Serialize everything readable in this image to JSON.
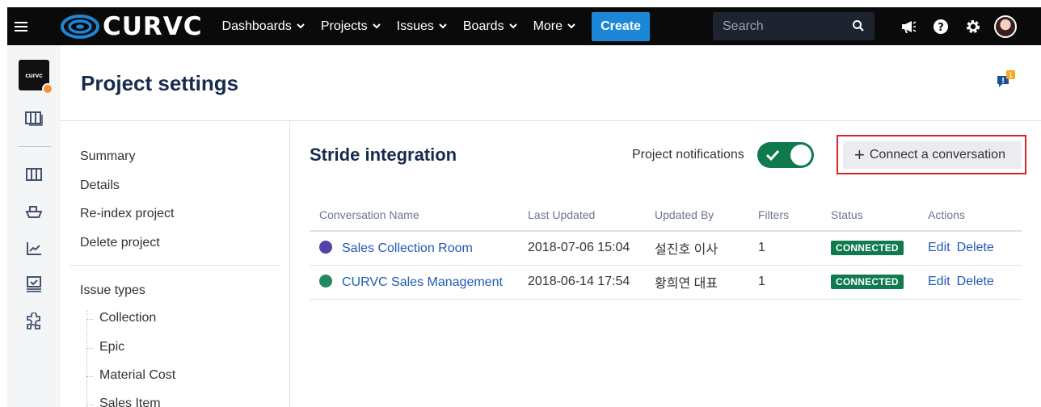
{
  "nav": {
    "logo_text": "CURVC",
    "menus": [
      {
        "label": "Dashboards"
      },
      {
        "label": "Projects"
      },
      {
        "label": "Issues"
      },
      {
        "label": "Boards"
      },
      {
        "label": "More"
      }
    ],
    "create_label": "Create",
    "search_placeholder": "Search",
    "icons": [
      "megaphone-icon",
      "help-icon",
      "settings-icon",
      "user-avatar"
    ]
  },
  "sidebar": {
    "project_avatar_text": "curvc",
    "icons": [
      "board-icon",
      "backlog-icon",
      "releases-icon",
      "reports-icon",
      "issues-icon",
      "add-ons-icon"
    ]
  },
  "header": {
    "title": "Project settings",
    "feedback_badge": "1"
  },
  "settings_nav": {
    "items": [
      "Summary",
      "Details",
      "Re-index project",
      "Delete project"
    ],
    "issue_types_label": "Issue types",
    "issue_types": [
      "Collection",
      "Epic",
      "Material Cost",
      "Sales Item"
    ]
  },
  "stride": {
    "title": "Stride integration",
    "notifications_label": "Project notifications",
    "notifications_on": true,
    "connect_label": "Connect a conversation",
    "columns": [
      "Conversation Name",
      "Last Updated",
      "Updated By",
      "Filters",
      "Status",
      "Actions"
    ],
    "rows": [
      {
        "name": "Sales Collection Room",
        "updated": "2018-07-06 15:04",
        "by": "설진호 이사",
        "filters": "1",
        "status": "CONNECTED",
        "edit": "Edit",
        "delete": "Delete",
        "icon_color": "#5243aa"
      },
      {
        "name": "CURVC Sales Management",
        "updated": "2018-06-14 17:54",
        "by": "황희연 대표",
        "filters": "1",
        "status": "CONNECTED",
        "edit": "Edit",
        "delete": "Delete",
        "icon_color": "#1f8a5e"
      }
    ]
  },
  "colors": {
    "nav_bg": "#0a0a0a",
    "create": "#1b87d6",
    "success": "#0e7a4e",
    "link": "#205bb5",
    "highlight": "#d8232a"
  }
}
